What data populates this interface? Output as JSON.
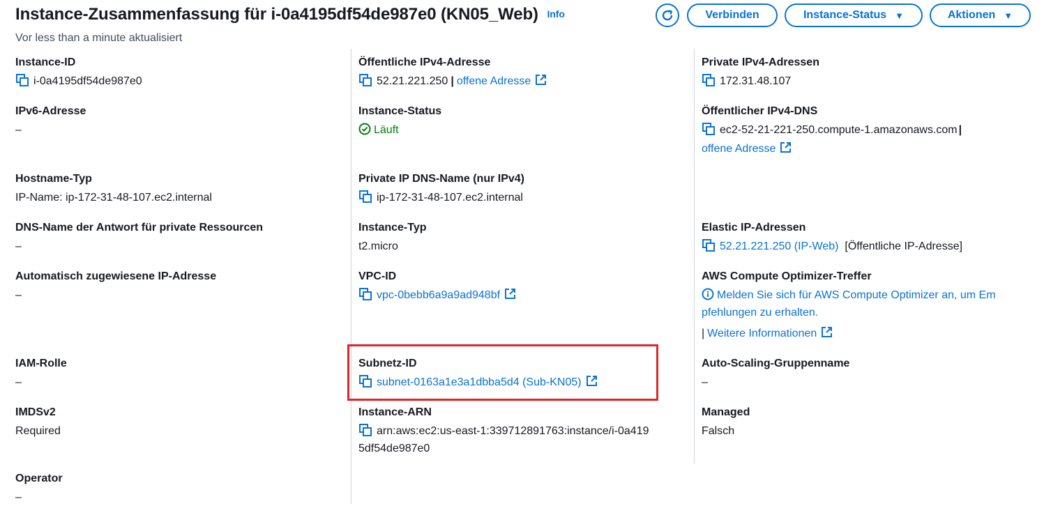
{
  "header": {
    "title": "Instance-Zusammenfassung für i-0a4195df54de987e0 (KN05_Web)",
    "info": "Info",
    "subtitle": "Vor less than a minute aktualisiert",
    "buttons": {
      "connect": "Verbinden",
      "instance_status": "Instance-Status",
      "actions": "Aktionen"
    }
  },
  "col1": {
    "instance_id": {
      "label": "Instance-ID",
      "value": "i-0a4195df54de987e0"
    },
    "ipv6": {
      "label": "IPv6-Adresse",
      "value": "–"
    },
    "hostname_type": {
      "label": "Hostname-Typ",
      "value": "IP-Name: ip-172-31-48-107.ec2.internal"
    },
    "dns_private": {
      "label": "DNS-Name der Antwort für private Ressourcen",
      "value": "–"
    },
    "auto_ip": {
      "label": "Automatisch zugewiesene IP-Adresse",
      "value": "–"
    },
    "iam_role": {
      "label": "IAM-Rolle",
      "value": "–"
    },
    "imdsv2": {
      "label": "IMDSv2",
      "value": "Required"
    },
    "operator": {
      "label": "Operator",
      "value": "–"
    }
  },
  "col2": {
    "public_ipv4": {
      "label": "Öffentliche IPv4-Adresse",
      "value": "52.21.221.250",
      "link": "offene Adresse"
    },
    "instance_status": {
      "label": "Instance-Status",
      "value": "Läuft"
    },
    "private_dns": {
      "label": "Private IP DNS-Name (nur IPv4)",
      "value": "ip-172-31-48-107.ec2.internal"
    },
    "instance_type": {
      "label": "Instance-Typ",
      "value": "t2.micro"
    },
    "vpc_id": {
      "label": "VPC-ID",
      "value": "vpc-0bebb6a9a9ad948bf"
    },
    "subnet_id": {
      "label": "Subnetz-ID",
      "value": "subnet-0163a1e3a1dbba5d4 (Sub-KN05)"
    },
    "instance_arn": {
      "label": "Instance-ARN",
      "value_line1": "arn:aws:ec2:us-east-1:339712891763:instance/i-0a419",
      "value_line2": "5df54de987e0"
    }
  },
  "col3": {
    "private_ipv4": {
      "label": "Private IPv4-Adressen",
      "value": "172.31.48.107"
    },
    "public_dns": {
      "label": "Öffentlicher IPv4-DNS",
      "value": "ec2-52-21-221-250.compute-1.amazonaws.com",
      "link": "offene Adresse"
    },
    "elastic_ip": {
      "label": "Elastic IP-Adressen",
      "value": "52.21.221.250 (IP-Web)",
      "suffix": "[Öffentliche IP-Adresse]"
    },
    "optimizer": {
      "label": "AWS Compute Optimizer-Treffer",
      "line1": "Melden Sie sich für AWS Compute Optimizer an, um Em",
      "line2": "pfehlungen zu erhalten.",
      "more": "Weitere Informationen"
    },
    "asg": {
      "label": "Auto-Scaling-Gruppenname",
      "value": "–"
    },
    "managed": {
      "label": "Managed",
      "value": "Falsch"
    }
  },
  "colors": {
    "link": "#0972d3",
    "running": "#037f0c",
    "highlight": "#e0242a"
  }
}
